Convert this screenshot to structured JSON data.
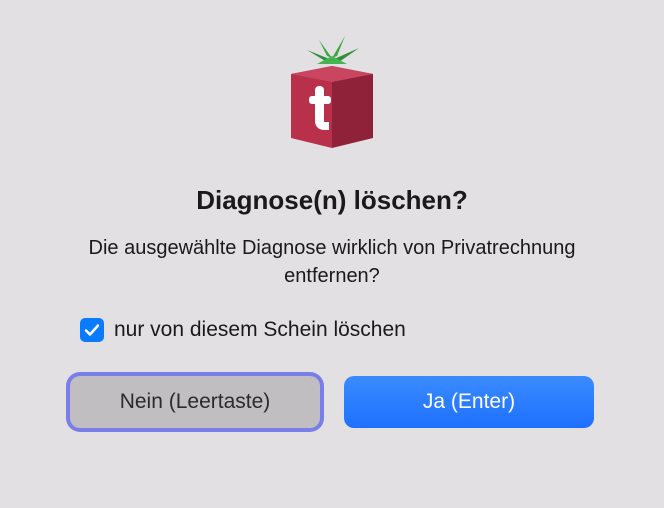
{
  "dialog": {
    "title": "Diagnose(n) löschen?",
    "message": "Die ausgewählte Diagnose wirklich von Privatrechnung entfernen?",
    "checkbox": {
      "label": "nur von diesem Schein löschen",
      "checked": true
    },
    "buttons": {
      "no_label": "Nein (Leertaste)",
      "yes_label": "Ja (Enter)"
    }
  },
  "icon": {
    "name": "tomedo-app-icon"
  }
}
